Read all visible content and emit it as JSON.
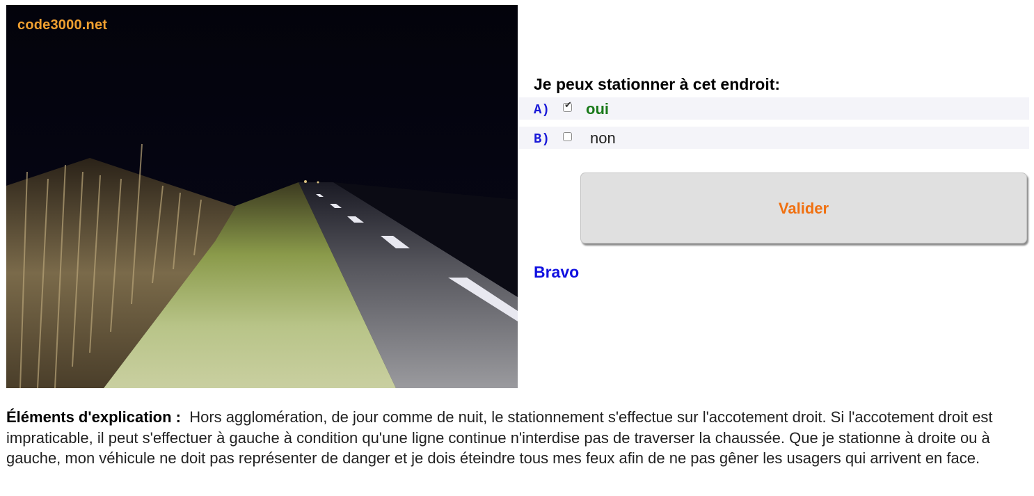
{
  "photo": {
    "watermark": "code3000.net"
  },
  "quiz": {
    "question": "Je peux stationner à cet endroit:",
    "answers": [
      {
        "letter": "A)",
        "text": "oui",
        "checked": true
      },
      {
        "letter": "B)",
        "text": "non",
        "checked": false
      }
    ],
    "validate_label": "Valider",
    "feedback": "Bravo"
  },
  "explanation": {
    "label": "Éléments d'explication :",
    "text": "Hors agglomération, de jour comme de nuit, le stationnement s'effectue sur l'accotement droit. Si l'accotement droit est impraticable, il peut s'effectuer à gauche à condition qu'une ligne continue n'interdise pas de traverser la chaussée. Que je stationne à droite ou à gauche, mon véhicule ne doit pas représenter de danger et je dois éteindre tous mes feux afin de ne pas gêner les usagers qui arrivent en face."
  },
  "colors": {
    "answer_letter": "#1a1ad8",
    "correct_answer": "#1a7a1a",
    "validate_text": "#f07010",
    "feedback": "#1010e0",
    "watermark": "#f0a030"
  }
}
